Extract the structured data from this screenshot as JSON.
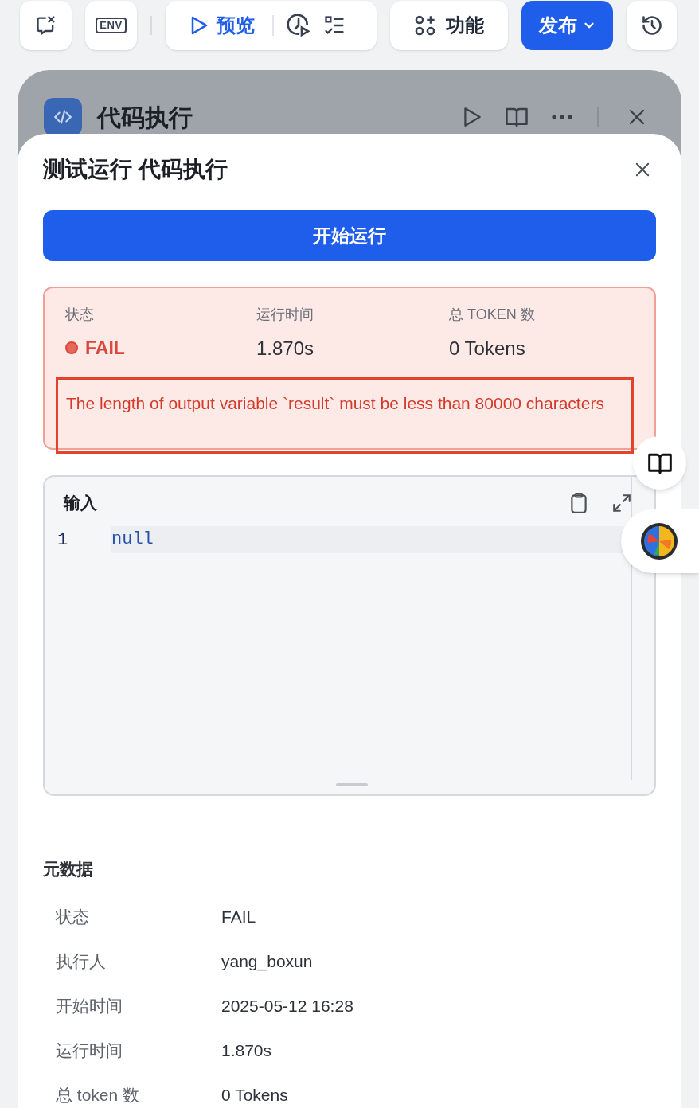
{
  "toolbar": {
    "env_label": "ENV",
    "preview": "预览",
    "features": "功能",
    "publish": "发布"
  },
  "node": {
    "title": "代码执行"
  },
  "dialog": {
    "title": "测试运行 代码执行",
    "run_button": "开始运行",
    "result": {
      "stats": [
        {
          "kind": "status",
          "label": "状态",
          "value": "FAIL",
          "color": "#e8675b"
        },
        {
          "kind": "text",
          "label": "运行时间",
          "value": "1.870s"
        },
        {
          "kind": "text",
          "label": "总 TOKEN 数",
          "value": "0 Tokens"
        }
      ],
      "error": "The length of output variable `result` must be less than 80000 characters"
    },
    "input": {
      "label": "输入",
      "lines": [
        {
          "number": "1",
          "code": "null"
        }
      ]
    },
    "metadata": {
      "title": "元数据",
      "rows": [
        {
          "label": "状态",
          "value": "FAIL"
        },
        {
          "label": "执行人",
          "value": "yang_boxun"
        },
        {
          "label": "开始时间",
          "value": "2025-05-12 16:28"
        },
        {
          "label": "运行时间",
          "value": "1.870s"
        },
        {
          "label": "总 token 数",
          "value": "0 Tokens"
        }
      ]
    }
  }
}
